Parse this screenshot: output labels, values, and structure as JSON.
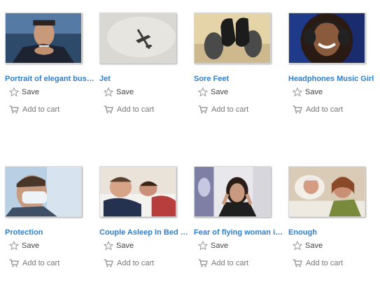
{
  "items": [
    {
      "title": "Portrait of elegant bus…",
      "save_label": "Save",
      "cart_label": "Add to cart",
      "image": "businessman-portrait"
    },
    {
      "title": "Jet",
      "save_label": "Save",
      "cart_label": "Add to cart",
      "image": "jet-in-sky"
    },
    {
      "title": "Sore Feet",
      "save_label": "Save",
      "cart_label": "Add to cart",
      "image": "feet-with-shoes"
    },
    {
      "title": "Headphones Music Girl",
      "save_label": "Save",
      "cart_label": "Add to cart",
      "image": "girl-headphones"
    },
    {
      "title": "Protection",
      "save_label": "Save",
      "cart_label": "Add to cart",
      "image": "man-face-mask"
    },
    {
      "title": "Couple Asleep In Bed …",
      "save_label": "Save",
      "cart_label": "Add to cart",
      "image": "couple-in-bed"
    },
    {
      "title": "Fear of flying woman i…",
      "save_label": "Save",
      "cart_label": "Add to cart",
      "image": "woman-airplane-window"
    },
    {
      "title": "Enough",
      "save_label": "Save",
      "cart_label": "Add to cart",
      "image": "elderly-couple-pillow"
    }
  ],
  "colors": {
    "title_link": "#2f7fcb",
    "save_text": "#444444",
    "cart_text": "#777777",
    "icon": "#9a9a9a"
  }
}
